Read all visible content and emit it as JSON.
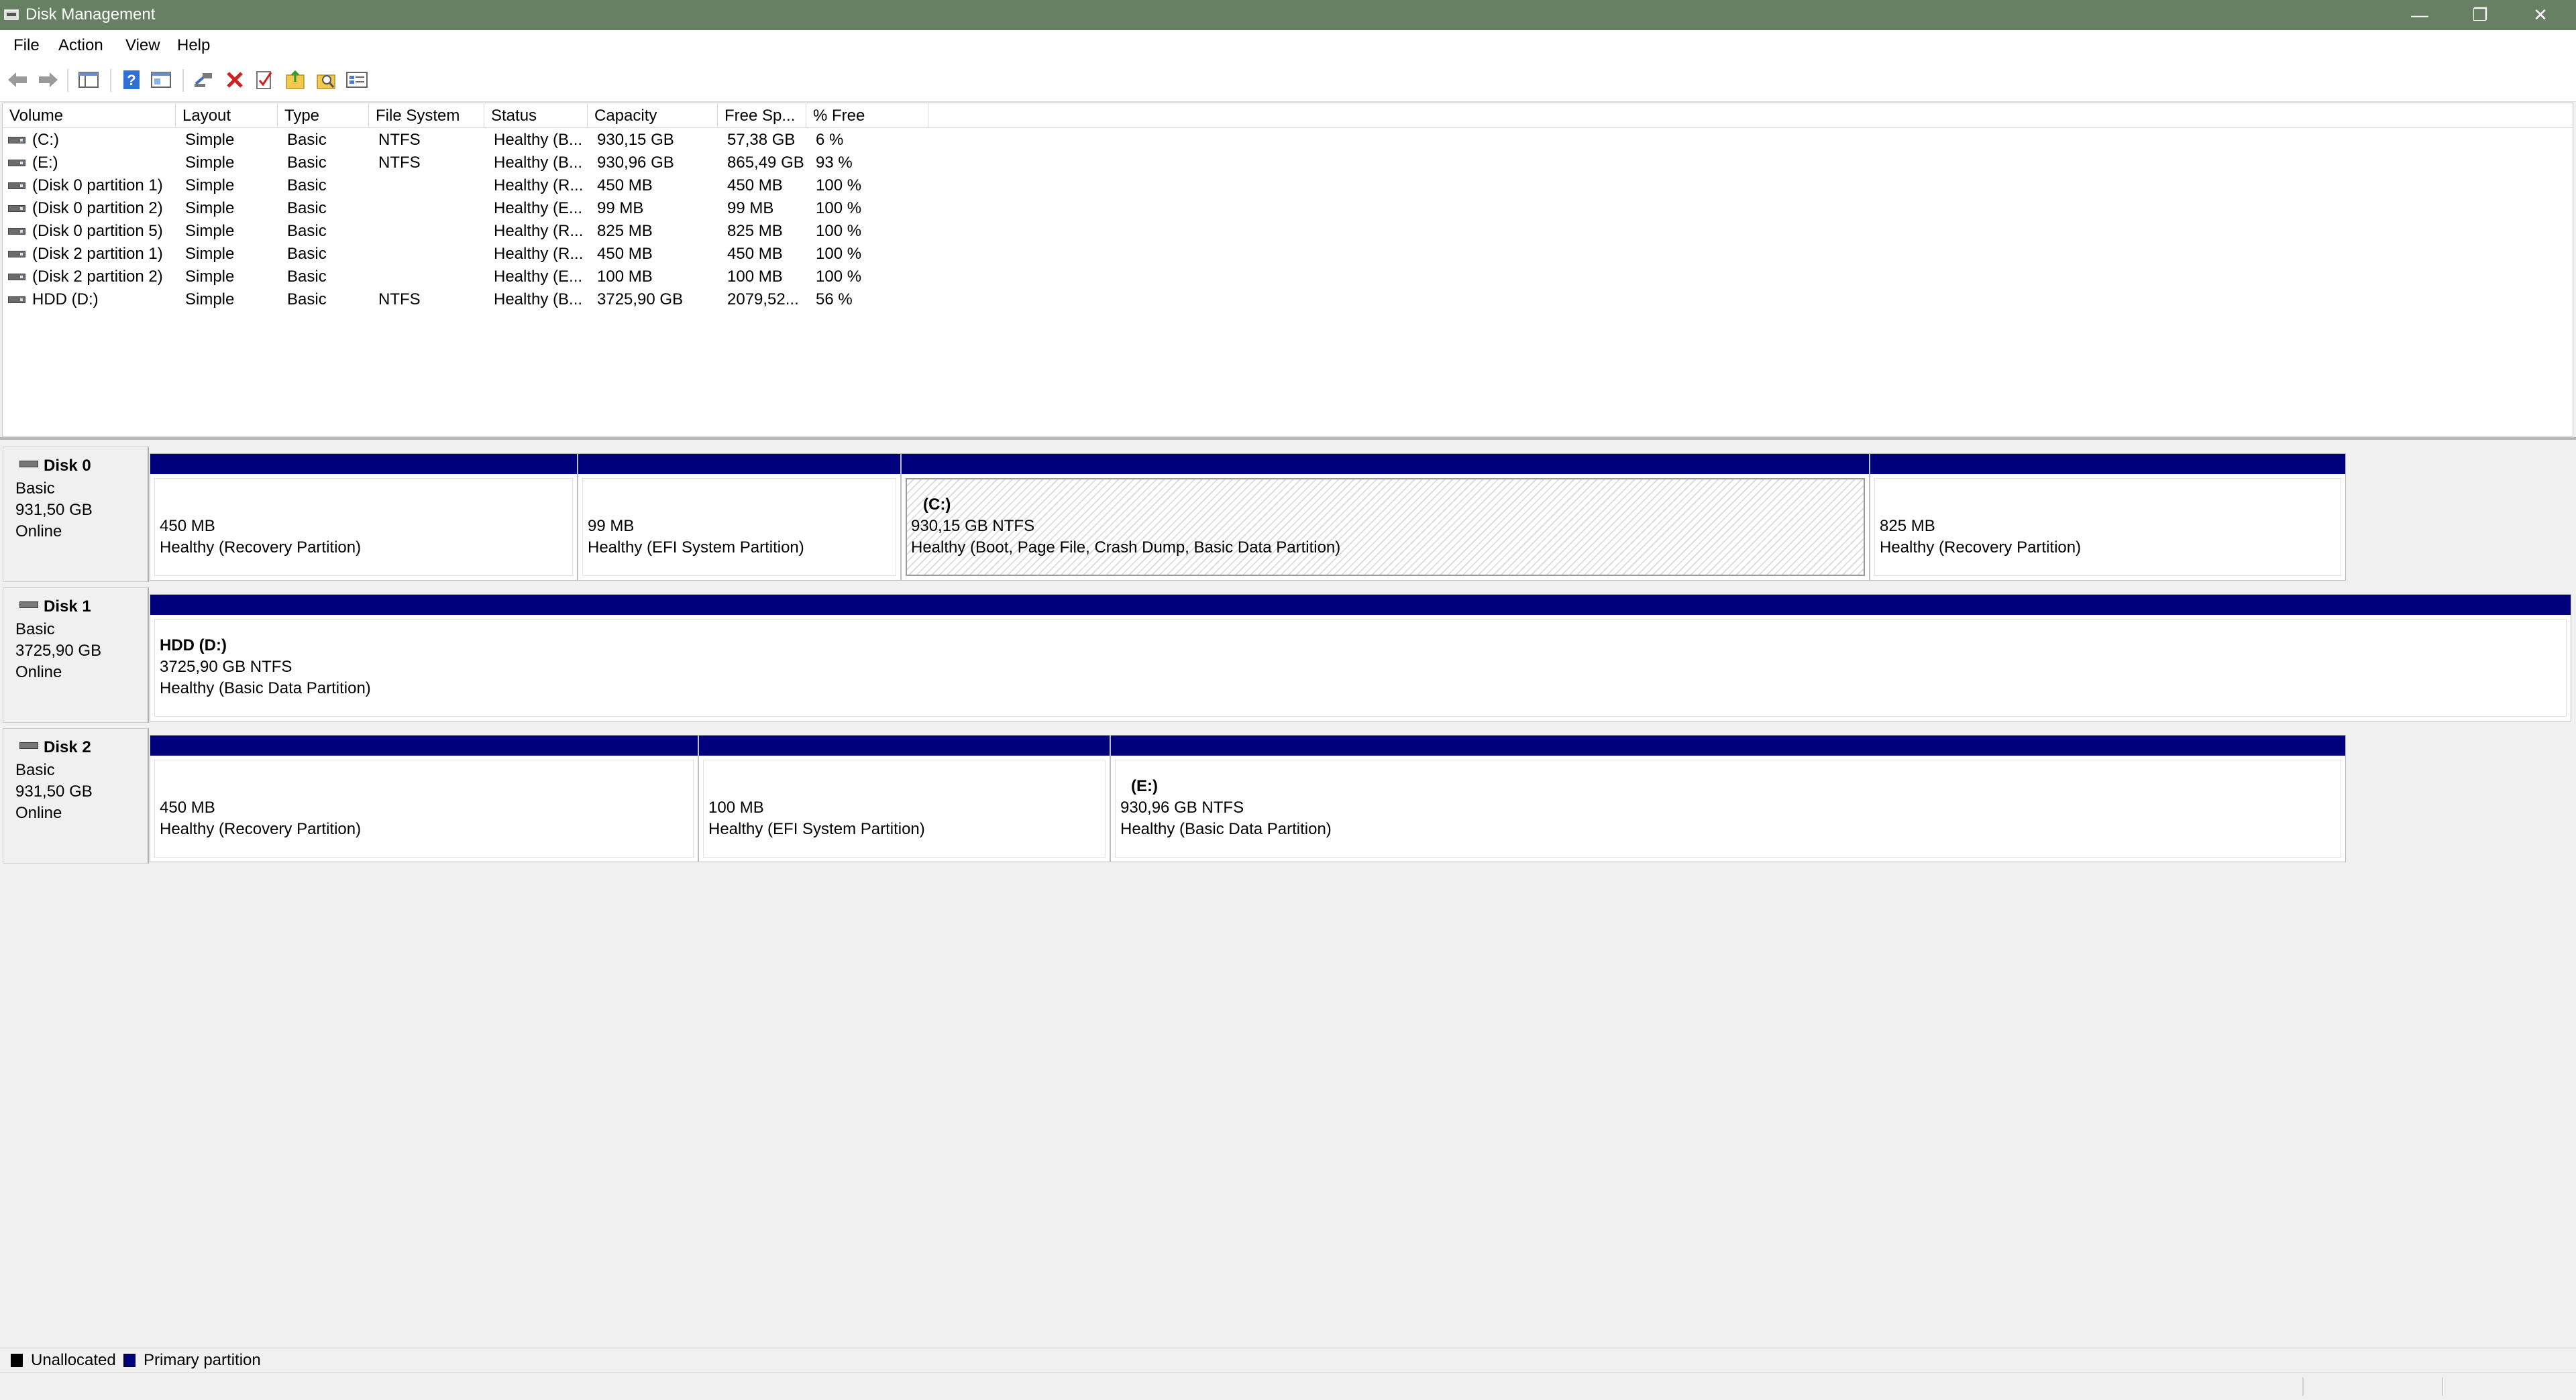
{
  "window": {
    "title": "Disk Management",
    "minimize": "—",
    "maximize": "❐",
    "close": "✕"
  },
  "menu": [
    "File",
    "Action",
    "View",
    "Help"
  ],
  "columns": [
    "Volume",
    "Layout",
    "Type",
    "File System",
    "Status",
    "Capacity",
    "Free Sp...",
    "% Free"
  ],
  "volumes": [
    [
      "(C:)",
      "Simple",
      "Basic",
      "NTFS",
      "Healthy (B...",
      "930,15 GB",
      "57,38 GB",
      "6 %"
    ],
    [
      "(E:)",
      "Simple",
      "Basic",
      "NTFS",
      "Healthy (B...",
      "930,96 GB",
      "865,49 GB",
      "93 %"
    ],
    [
      "(Disk 0 partition 1)",
      "Simple",
      "Basic",
      "",
      "Healthy (R...",
      "450 MB",
      "450 MB",
      "100 %"
    ],
    [
      "(Disk 0 partition 2)",
      "Simple",
      "Basic",
      "",
      "Healthy (E...",
      "99 MB",
      "99 MB",
      "100 %"
    ],
    [
      "(Disk 0 partition 5)",
      "Simple",
      "Basic",
      "",
      "Healthy (R...",
      "825 MB",
      "825 MB",
      "100 %"
    ],
    [
      "(Disk 2 partition 1)",
      "Simple",
      "Basic",
      "",
      "Healthy (R...",
      "450 MB",
      "450 MB",
      "100 %"
    ],
    [
      "(Disk 2 partition 2)",
      "Simple",
      "Basic",
      "",
      "Healthy (E...",
      "100 MB",
      "100 MB",
      "100 %"
    ],
    [
      "HDD (D:)",
      "Simple",
      "Basic",
      "NTFS",
      "Healthy (B...",
      "3725,90 GB",
      "2079,52...",
      "56 %"
    ]
  ],
  "disks": [
    {
      "name": "Disk 0",
      "type": "Basic",
      "size": "931,50 GB",
      "state": "Online",
      "partitions": [
        {
          "label": "",
          "size": "450 MB",
          "status": "Healthy (Recovery Partition)"
        },
        {
          "label": "",
          "size": "99 MB",
          "status": "Healthy (EFI System Partition)"
        },
        {
          "label": "(C:)",
          "size": "930,15 GB NTFS",
          "status": "Healthy (Boot, Page File, Crash Dump, Basic Data Partition)"
        },
        {
          "label": "",
          "size": "825 MB",
          "status": "Healthy (Recovery Partition)"
        }
      ]
    },
    {
      "name": "Disk 1",
      "type": "Basic",
      "size": "3725,90 GB",
      "state": "Online",
      "partitions": [
        {
          "label": "HDD  (D:)",
          "size": "3725,90 GB NTFS",
          "status": "Healthy (Basic Data Partition)"
        }
      ]
    },
    {
      "name": "Disk 2",
      "type": "Basic",
      "size": "931,50 GB",
      "state": "Online",
      "partitions": [
        {
          "label": "",
          "size": "450 MB",
          "status": "Healthy (Recovery Partition)"
        },
        {
          "label": "",
          "size": "100 MB",
          "status": "Healthy (EFI System Partition)"
        },
        {
          "label": "(E:)",
          "size": "930,96 GB NTFS",
          "status": "Healthy (Basic Data Partition)"
        }
      ]
    }
  ],
  "legend": {
    "unallocated": "Unallocated",
    "primary": "Primary partition"
  },
  "colors": {
    "titlebar": "#677f63",
    "primary": "#00007c",
    "unallocated": "#000000"
  }
}
